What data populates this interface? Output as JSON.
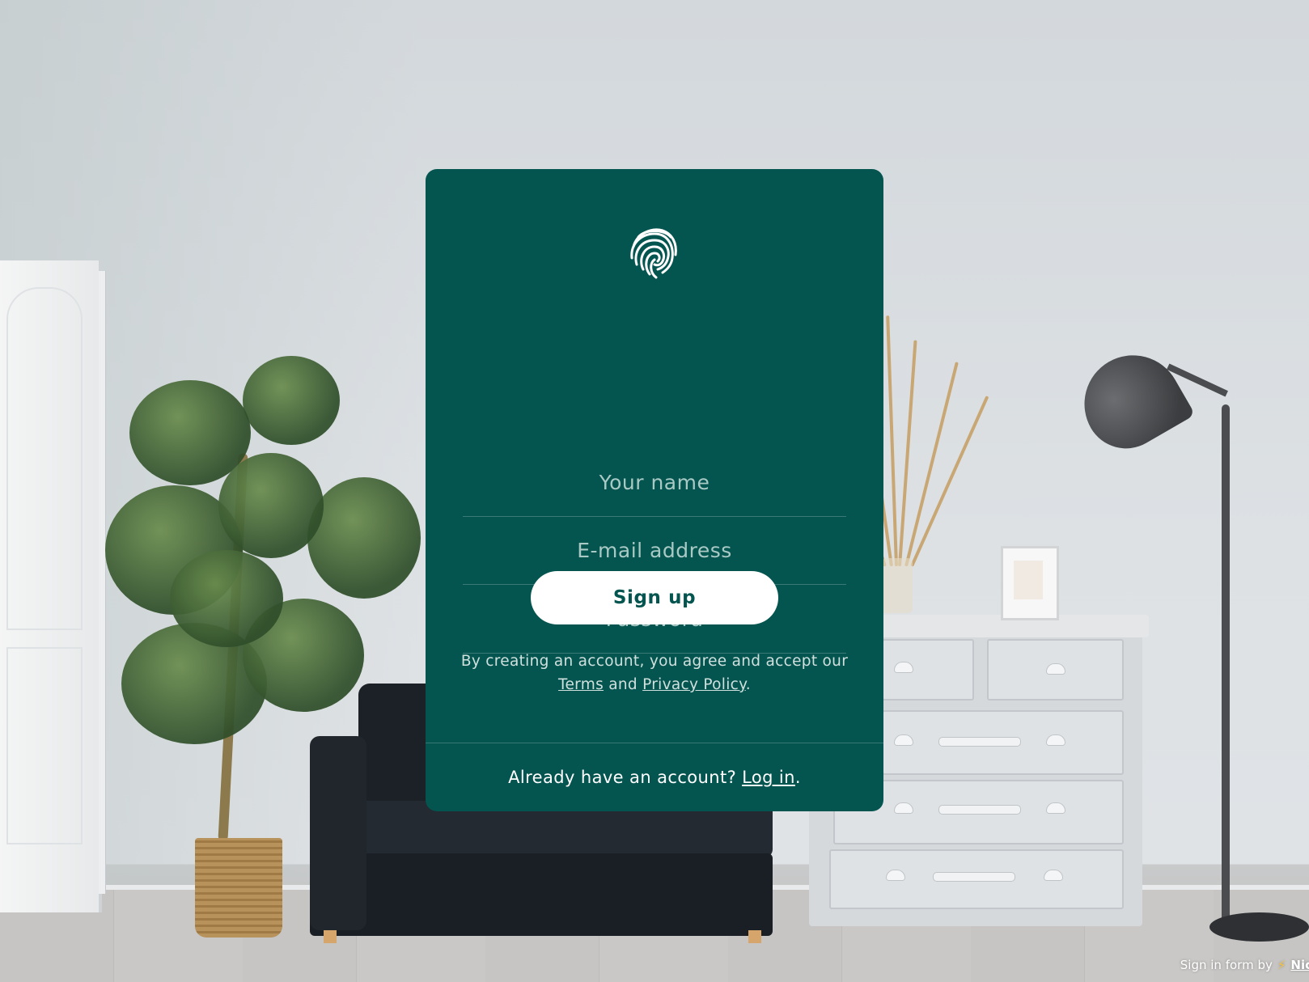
{
  "form": {
    "name_placeholder": "Your name",
    "email_placeholder": "E-mail address",
    "password_placeholder": "Password",
    "submit_label": "Sign up",
    "terms_prefix": "By creating an account, you agree and accept our",
    "terms_link": "Terms",
    "terms_and": "and",
    "privacy_link": "Privacy Policy",
    "terms_suffix": "."
  },
  "footer": {
    "prompt": "Already have an account?",
    "login_link": "Log in",
    "suffix": "."
  },
  "credit": {
    "text": "Sign in form by",
    "icon": "lightning-icon",
    "author_link": "Nic"
  },
  "logo_icon": "fingerprint-icon",
  "colors": {
    "card_background": "#045450",
    "button_background": "#ffffff",
    "button_text": "#045450",
    "placeholder_text": "#a9c9c4"
  }
}
